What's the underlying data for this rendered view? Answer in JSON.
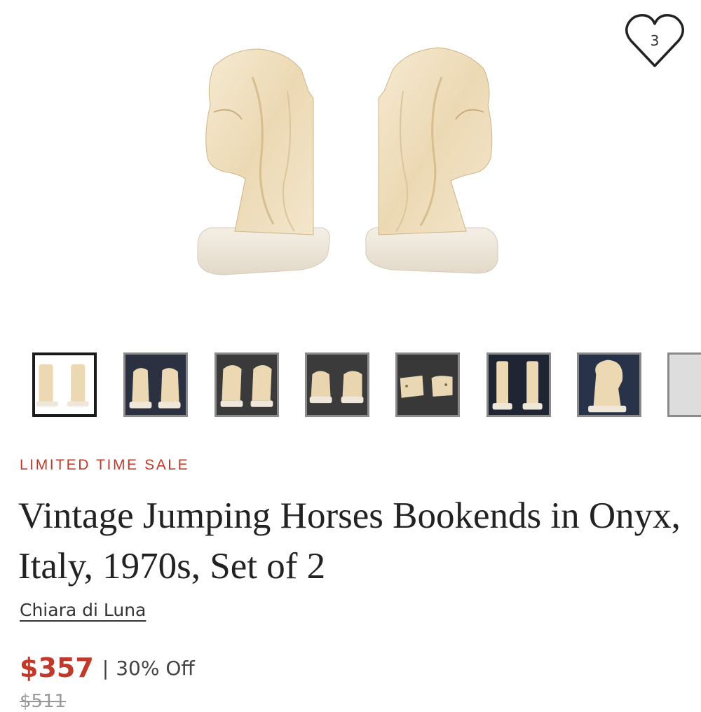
{
  "favorite": {
    "count": "3",
    "icon": "heart-outline-icon"
  },
  "gallery": {
    "main_image": "onyx-horse-bookends-photo",
    "thumbnails": [
      {
        "name": "thumbnail-1",
        "bg": "#ffffff",
        "active": true
      },
      {
        "name": "thumbnail-2",
        "bg": "#2b3140",
        "active": false
      },
      {
        "name": "thumbnail-3",
        "bg": "#3a3a3a",
        "active": false
      },
      {
        "name": "thumbnail-4",
        "bg": "#3b3b3b",
        "active": false
      },
      {
        "name": "thumbnail-5",
        "bg": "#383838",
        "active": false
      },
      {
        "name": "thumbnail-6",
        "bg": "#1f2533",
        "active": false
      },
      {
        "name": "thumbnail-7",
        "bg": "#283248",
        "active": false
      },
      {
        "name": "thumbnail-8",
        "bg": "#dddddd",
        "active": false
      }
    ]
  },
  "product": {
    "sale_label": "LIMITED TIME SALE",
    "title": "Vintage Jumping Horses Bookends in Onyx, Italy, 1970s, Set of 2",
    "seller": "Chiara di Luna",
    "price": "$357",
    "separator": "|",
    "discount": "30% Off",
    "original_price": "$511"
  },
  "colors": {
    "sale": "#c0392b",
    "onyx": "#f1e2c6",
    "onyx_dark": "#d9c39a"
  }
}
